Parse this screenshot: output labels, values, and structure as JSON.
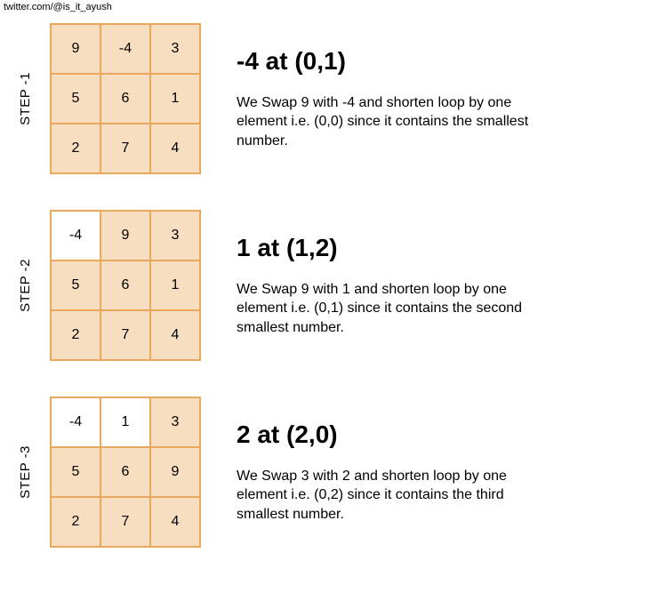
{
  "credit": "twitter.com/@is_it_ayush",
  "steps": [
    {
      "label": "STEP -1",
      "title": "-4 at (0,1)",
      "body": "We Swap 9 with -4 and shorten loop by one element i.e. (0,0) since it contains the smallest number.",
      "grid": [
        {
          "v": "9",
          "hi": true
        },
        {
          "v": "-4",
          "hi": true
        },
        {
          "v": "3",
          "hi": true
        },
        {
          "v": "5",
          "hi": true
        },
        {
          "v": "6",
          "hi": true
        },
        {
          "v": "1",
          "hi": true
        },
        {
          "v": "2",
          "hi": true
        },
        {
          "v": "7",
          "hi": true
        },
        {
          "v": "4",
          "hi": true
        }
      ]
    },
    {
      "label": "STEP -2",
      "title": "1 at (1,2)",
      "body": "We Swap 9 with 1 and shorten loop by one element i.e. (0,1) since it contains the second smallest number.",
      "grid": [
        {
          "v": "-4",
          "hi": false
        },
        {
          "v": "9",
          "hi": true
        },
        {
          "v": "3",
          "hi": true
        },
        {
          "v": "5",
          "hi": true
        },
        {
          "v": "6",
          "hi": true
        },
        {
          "v": "1",
          "hi": true
        },
        {
          "v": "2",
          "hi": true
        },
        {
          "v": "7",
          "hi": true
        },
        {
          "v": "4",
          "hi": true
        }
      ]
    },
    {
      "label": "STEP -3",
      "title": "2 at (2,0)",
      "body": "We Swap 3 with 2 and shorten loop by one element i.e. (0,2) since it contains the third smallest number.",
      "grid": [
        {
          "v": "-4",
          "hi": false
        },
        {
          "v": "1",
          "hi": false
        },
        {
          "v": "3",
          "hi": true
        },
        {
          "v": "5",
          "hi": true
        },
        {
          "v": "6",
          "hi": true
        },
        {
          "v": "9",
          "hi": true
        },
        {
          "v": "2",
          "hi": true
        },
        {
          "v": "7",
          "hi": true
        },
        {
          "v": "4",
          "hi": true
        }
      ]
    }
  ]
}
